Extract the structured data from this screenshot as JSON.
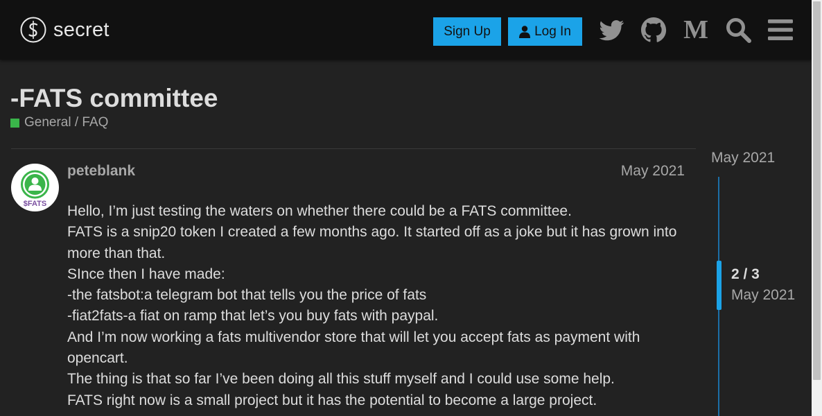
{
  "header": {
    "logo_text": "secret",
    "signup_label": "Sign Up",
    "login_label": "Log In",
    "icons": [
      "twitter-icon",
      "github-icon",
      "medium-icon",
      "search-icon",
      "hamburger-menu-icon"
    ],
    "medium_glyph": "M"
  },
  "topic": {
    "title": "-FATS committee",
    "category": "General / FAQ",
    "category_color": "#3ab54a"
  },
  "post": {
    "username": "peteblank",
    "date": "May 2021",
    "avatar_text": "$FATS",
    "lines": [
      "Hello, I’m just testing the waters on whether there could be a FATS committee.",
      "FATS is a snip20 token I created a few months ago. It started off as a joke but it has grown into more than that.",
      "SInce then I have made:",
      "-the fatsbot:a telegram bot that tells you the price of fats",
      "-fiat2fats-a fiat on ramp that let’s you buy fats with paypal.",
      "And I’m now working a fats multivendor store that will let you accept fats as payment with opencart.",
      "The thing is that so far I’ve been doing all this stuff myself and I could use some help.",
      "FATS right now is a small project but it has the potential to become a large project."
    ]
  },
  "timeline": {
    "start_date": "May 2021",
    "count": "2 / 3",
    "current_date": "May 2021"
  },
  "colors": {
    "accent": "#1ba3e8",
    "background": "#222222",
    "header": "#111111"
  }
}
